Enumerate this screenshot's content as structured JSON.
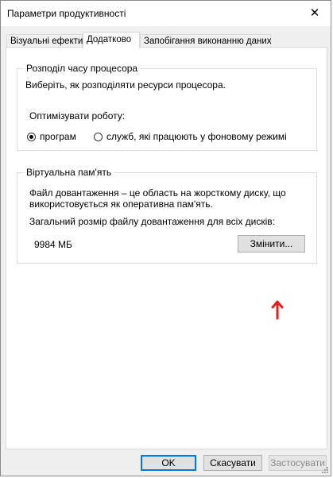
{
  "window": {
    "title": "Параметри продуктивності",
    "close_glyph": "✕"
  },
  "tabs": [
    {
      "label": "Візуальні ефекти"
    },
    {
      "label": "Додатково"
    },
    {
      "label": "Запобігання виконанню даних"
    }
  ],
  "active_tab": "Додатково",
  "processor": {
    "title": "Розподіл часу процесора",
    "description": "Виберіть, як розподіляти ресурси процесора.",
    "optimize_label": "Оптимізувати роботу:",
    "options": [
      {
        "label": "програм",
        "selected": true
      },
      {
        "label": "служб, які працюють у фоновому режимі",
        "selected": false
      }
    ]
  },
  "virtual_memory": {
    "title": "Віртуальна пам'ять",
    "description_line1": "Файл довантаження – це область на жорсткому диску, що",
    "description_line2": "використовується як оперативна пам'ять.",
    "total_label": "Загальний розмір файлу довантаження для всіх дисків:",
    "total_value": "9984 МБ",
    "change_button": "Змінити..."
  },
  "footer": {
    "ok": "OK",
    "cancel": "Скасувати",
    "apply": "Застосувати"
  },
  "annotation": {
    "arrow_color": "#e02020"
  },
  "colors": {
    "accent": "#0078d7",
    "annotation": "#e02020"
  }
}
